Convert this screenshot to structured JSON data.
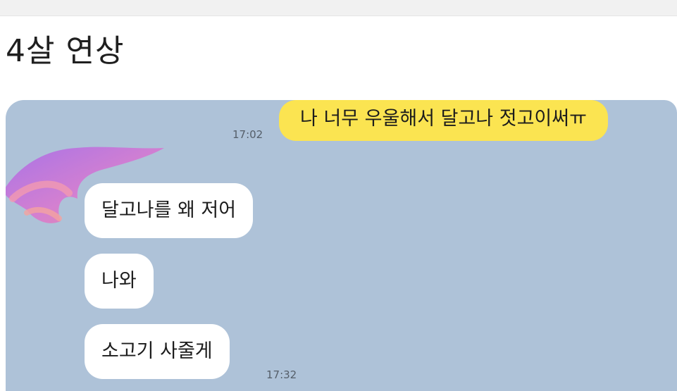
{
  "post": {
    "caption": "4살 연상"
  },
  "chat": {
    "messages": [
      {
        "side": "sent",
        "text": "나 너무 우울해서 달고나 젓고이써ㅠ",
        "time": "17:02"
      },
      {
        "side": "received",
        "text": "달고나를 왜 저어"
      },
      {
        "side": "received",
        "text": "나와"
      },
      {
        "side": "received",
        "text": "소고기 사줄게",
        "time": "17:32"
      }
    ]
  },
  "colors": {
    "chat_background": "#aec2d8",
    "sent_bubble": "#fbe451",
    "received_bubble": "#ffffff",
    "avatar_scribble": "#c77ad9"
  },
  "icons": {
    "avatar": "hidden-avatar-scribble"
  }
}
